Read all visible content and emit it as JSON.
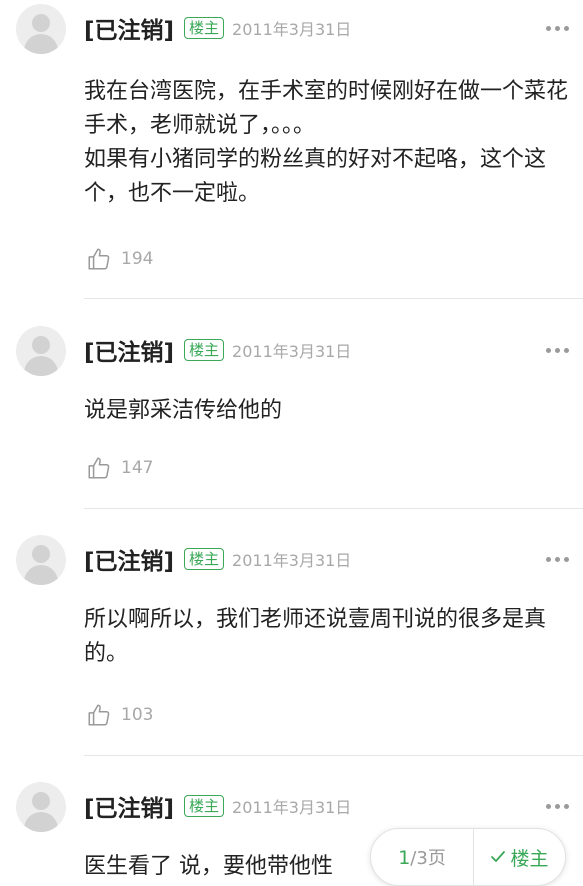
{
  "posts": [
    {
      "author": "[已注销]",
      "badge": "楼主",
      "date": "2011年3月31日",
      "content": "我在台湾医院，在手术室的时候刚好在做一个菜花手术，老师就说了，。。。\n如果有小猪同学的粉丝真的好对不起咯，这个这个，也不一定啦。",
      "likes": "194"
    },
    {
      "author": "[已注销]",
      "badge": "楼主",
      "date": "2011年3月31日",
      "content": "说是郭采洁传给他的",
      "likes": "147"
    },
    {
      "author": "[已注销]",
      "badge": "楼主",
      "date": "2011年3月31日",
      "content": "所以啊所以，我们老师还说壹周刊说的很多是真的。",
      "likes": "103"
    },
    {
      "author": "[已注销]",
      "badge": "楼主",
      "date": "2011年3月31日",
      "content": "医生看了 说，要他带他性"
    }
  ],
  "pager": {
    "current": "1",
    "total_label": "/3",
    "unit": "页",
    "owner_only_label": "楼主"
  },
  "colors": {
    "accent_green": "#3aa857",
    "meta_gray": "#a8a8a8",
    "divider": "#e6e6e6"
  }
}
